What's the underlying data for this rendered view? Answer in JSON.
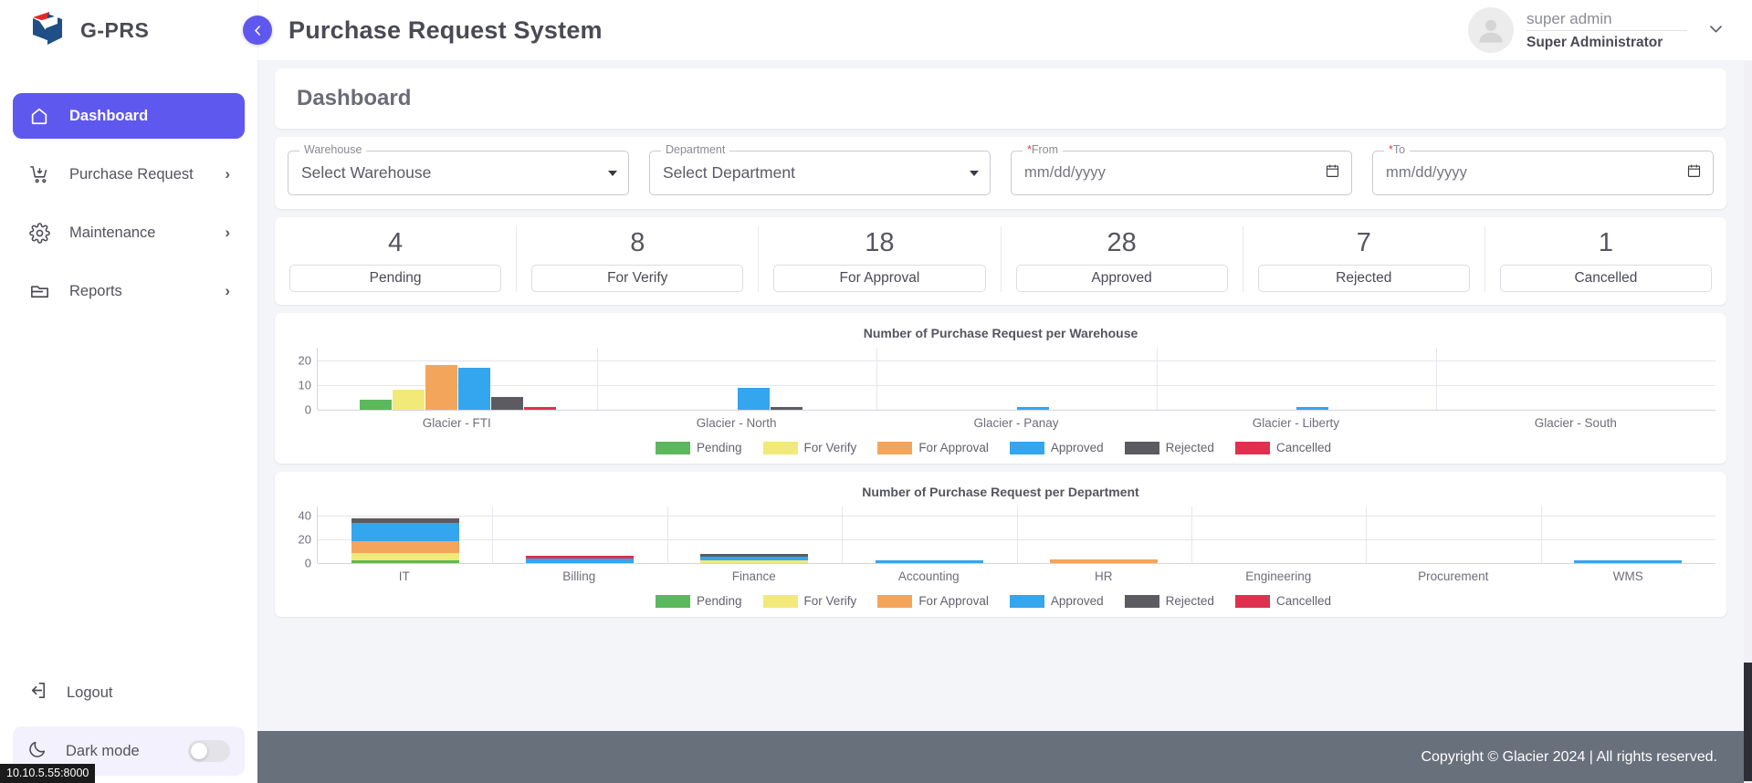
{
  "brand": {
    "name": "G-PRS"
  },
  "header": {
    "title": "Purchase Request System"
  },
  "user": {
    "name": "super admin",
    "role": "Super Administrator"
  },
  "sidebar": {
    "items": [
      {
        "label": "Dashboard",
        "icon": "home-icon",
        "chevron": "",
        "active": true
      },
      {
        "label": "Purchase Request",
        "icon": "cart-icon",
        "chevron": "›",
        "active": false
      },
      {
        "label": "Maintenance",
        "icon": "gear-icon",
        "chevron": "›",
        "active": false
      },
      {
        "label": "Reports",
        "icon": "folder-icon",
        "chevron": "›",
        "active": false
      }
    ],
    "logout": "Logout",
    "dark_mode": "Dark mode"
  },
  "status_tooltip": "10.10.5.55:8000",
  "page": {
    "title": "Dashboard"
  },
  "filters": [
    {
      "label": "Warehouse",
      "value": "Select Warehouse",
      "type": "select",
      "required": false
    },
    {
      "label": "Department",
      "value": "Select Department",
      "type": "select",
      "required": false
    },
    {
      "label": "From",
      "value": "mm/dd/yyyy",
      "type": "date",
      "required": true
    },
    {
      "label": "To",
      "value": "mm/dd/yyyy",
      "type": "date",
      "required": true
    }
  ],
  "stats": [
    {
      "count": "4",
      "label": "Pending"
    },
    {
      "count": "8",
      "label": "For Verify"
    },
    {
      "count": "18",
      "label": "For Approval"
    },
    {
      "count": "28",
      "label": "Approved"
    },
    {
      "count": "7",
      "label": "Rejected"
    },
    {
      "count": "1",
      "label": "Cancelled"
    }
  ],
  "colors": {
    "pending": "#5cb85c",
    "for_verify": "#f2ea78",
    "for_approval": "#f5a košík",
    "for_approval_hex": "#f4a55c",
    "approved": "#34a5ef",
    "rejected": "#5b5b61",
    "cancelled": "#e0304f",
    "accent": "#5f58ee",
    "footer": "#68707c"
  },
  "chart_data": [
    {
      "type": "bar",
      "title": "Number of Purchase Request per Warehouse",
      "xlabel": "",
      "ylabel": "",
      "ylim": [
        0,
        25
      ],
      "yticks": [
        0,
        10,
        20
      ],
      "grid": true,
      "legend_position": "bottom",
      "grouping": "grouped",
      "categories": [
        "Glacier - FTI",
        "Glacier - North",
        "Glacier - Panay",
        "Glacier - Liberty",
        "Glacier - South"
      ],
      "series": [
        {
          "name": "Pending",
          "color": "#5cb85c",
          "values": [
            4,
            0,
            0,
            0,
            0
          ]
        },
        {
          "name": "For Verify",
          "color": "#f2ea78",
          "values": [
            8,
            0,
            0,
            0,
            0
          ]
        },
        {
          "name": "For Approval",
          "color": "#f4a55c",
          "values": [
            18,
            0,
            0,
            0,
            0
          ]
        },
        {
          "name": "Approved",
          "color": "#34a5ef",
          "values": [
            17,
            9,
            1,
            1,
            0
          ]
        },
        {
          "name": "Rejected",
          "color": "#5b5b61",
          "values": [
            5,
            1,
            0,
            0,
            0
          ]
        },
        {
          "name": "Cancelled",
          "color": "#e0304f",
          "values": [
            1,
            0,
            0,
            0,
            0
          ]
        }
      ]
    },
    {
      "type": "bar",
      "title": "Number of Purchase Request per Department",
      "xlabel": "",
      "ylabel": "",
      "ylim": [
        0,
        48
      ],
      "yticks": [
        0,
        20,
        40
      ],
      "grid": true,
      "legend_position": "bottom",
      "grouping": "stacked",
      "categories": [
        "IT",
        "Billing",
        "Finance",
        "Accounting",
        "HR",
        "Engineering",
        "Procurement",
        "WMS"
      ],
      "series": [
        {
          "name": "Pending",
          "color": "#5cb85c",
          "values": [
            2,
            0,
            0,
            0,
            0,
            0,
            0,
            0
          ]
        },
        {
          "name": "For Verify",
          "color": "#f2ea78",
          "values": [
            6,
            0,
            1,
            0,
            0,
            0,
            0,
            0
          ]
        },
        {
          "name": "For Approval",
          "color": "#f4a55c",
          "values": [
            10,
            0,
            0,
            0,
            3,
            0,
            0,
            0
          ]
        },
        {
          "name": "Approved",
          "color": "#34a5ef",
          "values": [
            16,
            4,
            3,
            2,
            0,
            0,
            0,
            1
          ]
        },
        {
          "name": "Rejected",
          "color": "#5b5b61",
          "values": [
            4,
            0,
            1,
            0,
            0,
            0,
            0,
            0
          ]
        },
        {
          "name": "Cancelled",
          "color": "#e0304f",
          "values": [
            0,
            1,
            0,
            0,
            0,
            0,
            0,
            0
          ]
        }
      ]
    }
  ],
  "footer": {
    "text": "Copyright © Glacier 2024  |  All rights reserved."
  }
}
